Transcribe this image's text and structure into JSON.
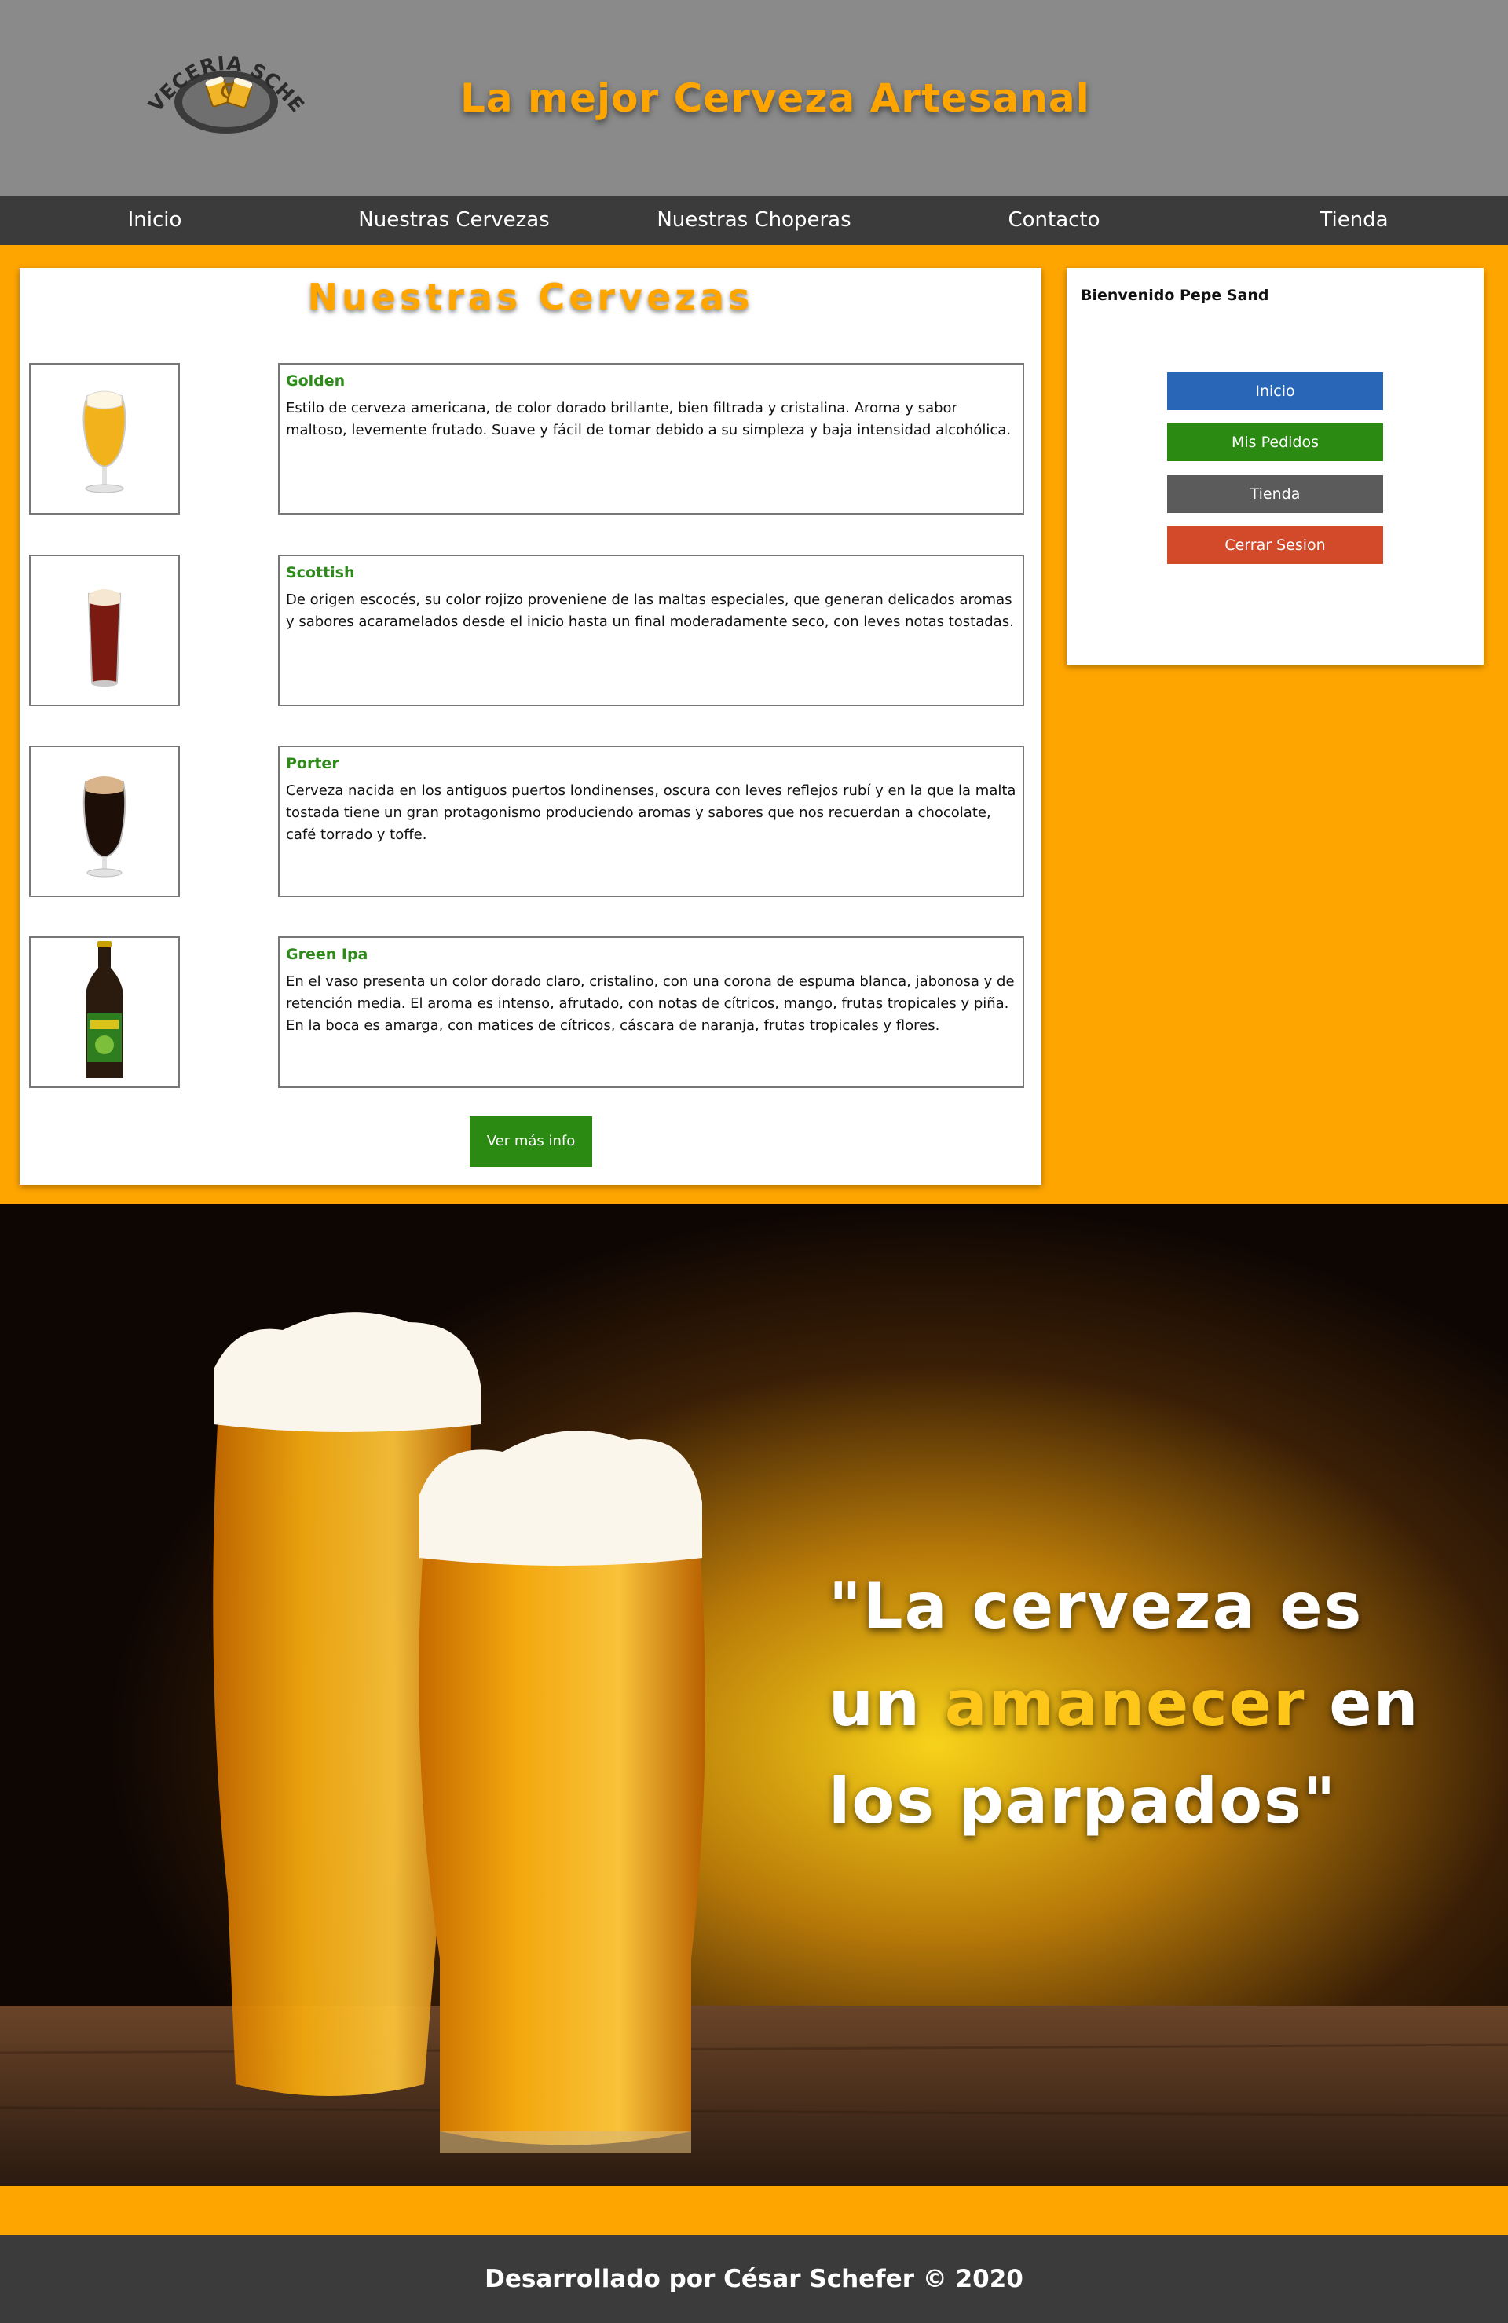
{
  "header": {
    "logo_text": "CERVECERIA SCHEFER",
    "tagline": "La mejor Cerveza Artesanal"
  },
  "nav": {
    "items": [
      {
        "label": "Inicio"
      },
      {
        "label": "Nuestras Cervezas"
      },
      {
        "label": "Nuestras Choperas"
      },
      {
        "label": "Contacto"
      },
      {
        "label": "Tienda"
      }
    ]
  },
  "main": {
    "title": "Nuestras Cervezas",
    "beers": [
      {
        "name": "Golden",
        "description": "Estilo de cerveza americana, de color dorado brillante, bien filtrada y cristalina. Aroma y sabor maltoso, levemente frutado. Suave y fácil de tomar debido a su simpleza y baja intensidad alcohólica."
      },
      {
        "name": "Scottish",
        "description": "De origen escocés, su color rojizo proveniene de las maltas especiales, que generan delicados aromas y sabores acaramelados desde el inicio hasta un final moderadamente seco, con leves notas tostadas."
      },
      {
        "name": "Porter",
        "description": "Cerveza nacida en los antiguos puertos londinenses, oscura con leves reflejos rubí y en la que la malta tostada tiene un gran protagonismo produciendo aromas y sabores que nos recuerdan a chocolate, café torrado y toffe."
      },
      {
        "name": "Green Ipa",
        "description": "En el vaso presenta un color dorado claro, cristalino, con una corona de espuma blanca, jabonosa y de retención media. El aroma es intenso, afrutado, con notas de cítricos, mango, frutas tropicales y piña. En la boca es amarga, con matices de cítricos, cáscara de naranja, frutas tropicales y flores."
      }
    ],
    "more_button": "Ver más info"
  },
  "sidebar": {
    "welcome": "Bienvenido Pepe Sand",
    "buttons": [
      {
        "label": "Inicio",
        "color": "#2a66b8"
      },
      {
        "label": "Mis Pedidos",
        "color": "#2a8a12"
      },
      {
        "label": "Tienda",
        "color": "#5b5b5b"
      },
      {
        "label": "Cerrar Sesion",
        "color": "#d24a2a"
      }
    ]
  },
  "hero": {
    "quote_part1": "\"La cerveza es un",
    "quote_highlight": "amanecer",
    "quote_part2": "en los parpados\""
  },
  "footer": {
    "text": "Desarrollado por César Schefer © 2020"
  },
  "colors": {
    "accent": "#ffa500",
    "header_bg": "#8a8a8a",
    "nav_bg": "#3b3b3b",
    "beer_name": "#2e8b1b",
    "quote_highlight": "#ffc61a"
  }
}
